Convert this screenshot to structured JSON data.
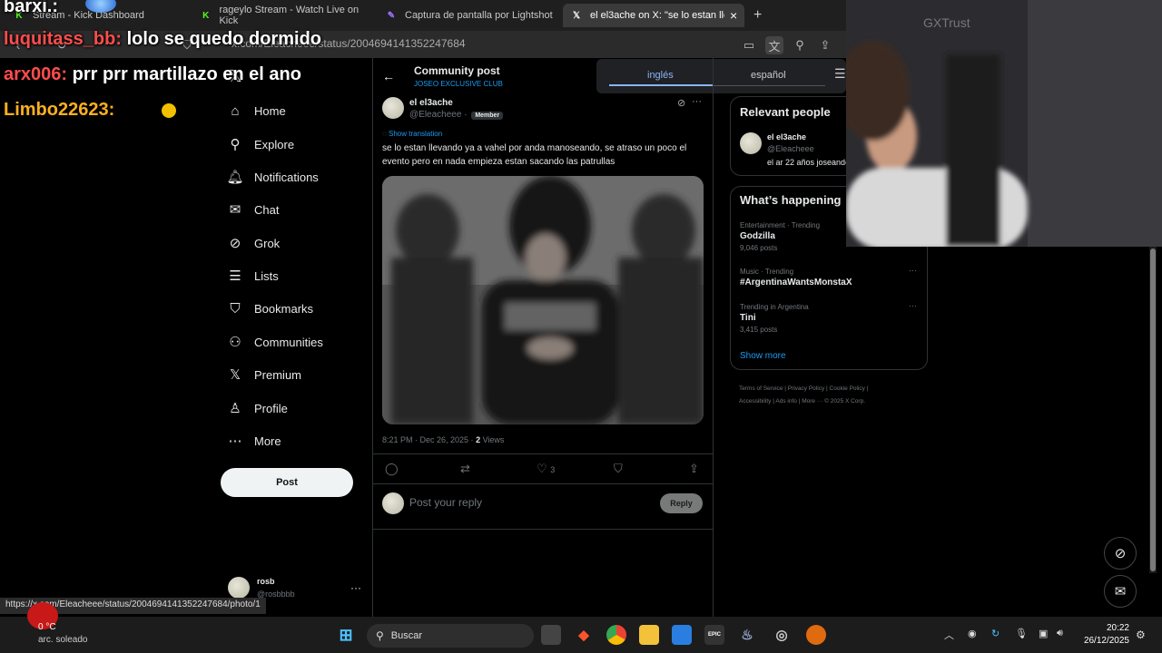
{
  "browser": {
    "tabs": [
      {
        "label": "Stream - Kick Dashboard"
      },
      {
        "label": "rageylo Stream - Watch Live on Kick"
      },
      {
        "label": "Captura de pantalla por Lightshot"
      },
      {
        "label": "el el3ache on X: \"se lo estan llev"
      }
    ],
    "new_tab": "+",
    "close_tab": "×",
    "url": "x.com/Eleacheee/status/2004694141352247684",
    "status_url": "https://x.com/Eleacheee/status/2004694141352247684/photo/1"
  },
  "stream_chat": [
    {
      "user": "barxi.:",
      "msg": ""
    },
    {
      "user": "luquitass_bb:",
      "msg": " lolo se quedo dormido",
      "color": "#ff4d4d"
    },
    {
      "user": "arx006:",
      "msg": " prr prr martillazo en el ano",
      "color": "#ff4d4d"
    },
    {
      "user": "Limbo22623:",
      "msg": "",
      "color": "#ffb020"
    }
  ],
  "translate": {
    "tabs": [
      "inglés",
      "español"
    ]
  },
  "nav": {
    "items": [
      {
        "label": "Home",
        "icon": "home-icon",
        "glyph": "⌂"
      },
      {
        "label": "Explore",
        "icon": "search-icon",
        "glyph": "⚲"
      },
      {
        "label": "Notifications",
        "icon": "bell-icon",
        "glyph": "🔔︎"
      },
      {
        "label": "Chat",
        "icon": "mail-icon",
        "glyph": "✉"
      },
      {
        "label": "Grok",
        "icon": "grok-icon",
        "glyph": "⊘"
      },
      {
        "label": "Lists",
        "icon": "list-icon",
        "glyph": "☰"
      },
      {
        "label": "Bookmarks",
        "icon": "bookmark-icon",
        "glyph": "⛉"
      },
      {
        "label": "Communities",
        "icon": "people-icon",
        "glyph": "⚇"
      },
      {
        "label": "Premium",
        "icon": "x-logo-icon",
        "glyph": "𝕏"
      },
      {
        "label": "Profile",
        "icon": "person-icon",
        "glyph": "♙"
      },
      {
        "label": "More",
        "icon": "more-circle-icon",
        "glyph": "⋯"
      }
    ],
    "post_label": "Post",
    "account": {
      "name": "rosb",
      "handle": "@rosbbbb"
    }
  },
  "post": {
    "header_title": "Community post",
    "community": "JOSEO EXCLUSIVE CLUB",
    "author_name": "el el3ache",
    "author_handle": "@Eleacheee",
    "separator": "·",
    "badge": "Member",
    "show_translation": "Show translation",
    "text": "se lo estan llevando ya a vahel por anda manoseando, se atraso un poco el evento pero en nada empieza estan sacando las patrullas",
    "timestamp": "8:21 PM · Dec 26, 2025 · ",
    "views_count": "2",
    "views_label": " Views",
    "likes": "3",
    "reply_placeholder": "Post your reply",
    "reply_button": "Reply"
  },
  "right": {
    "relevant_title": "Relevant people",
    "person": {
      "name": "el el3ache",
      "handle": "@Eleacheee",
      "bio": "el ar 22 años joseando"
    },
    "happening_title": "What’s happening",
    "trends": [
      {
        "meta": "Entertainment · Trending",
        "name": "Godzilla",
        "posts": "9,046 posts"
      },
      {
        "meta": "Music · Trending",
        "name": "#ArgentinaWantsMonstaX",
        "posts": ""
      },
      {
        "meta": "Trending in Argentina",
        "name": "Tini",
        "posts": "3,415 posts"
      }
    ],
    "show_more": "Show more",
    "footer": [
      "Terms of Service",
      "|",
      "Privacy Policy",
      "|",
      "Cookie Policy",
      "|",
      "Accessibility",
      "|",
      "Ads info",
      "|",
      "More ···",
      "© 2025 X Corp."
    ]
  },
  "webcam": {
    "brand": "GXTrust"
  },
  "taskbar": {
    "weather_temp": "0 °C",
    "weather_desc": "arc. soleado",
    "search_label": "Buscar",
    "time": "20:22",
    "date": "26/12/2025"
  },
  "colors": {
    "accent": "#1d9bf0",
    "chat_red": "#ff4d4d",
    "chat_gold": "#ffb020"
  }
}
